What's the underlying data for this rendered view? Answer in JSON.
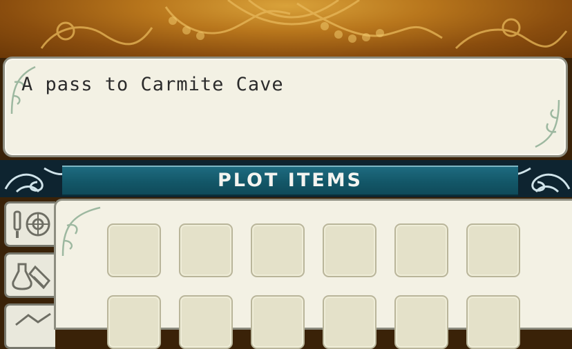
{
  "description": {
    "text": "A pass to Carmite Cave"
  },
  "category": {
    "title": "PLOT ITEMS"
  },
  "side_tabs": [
    {
      "icon": "sword-shield-icon"
    },
    {
      "icon": "potion-scroll-icon"
    },
    {
      "icon": "misc-item-icon"
    }
  ],
  "grid": {
    "rows_visible": 2,
    "columns": 6,
    "slots_filled": 0
  },
  "colors": {
    "banner_gold": "#b8761c",
    "panel_cream": "#f3f1e4",
    "header_teal": "#135768",
    "slot_fill": "#e4e1c9"
  }
}
